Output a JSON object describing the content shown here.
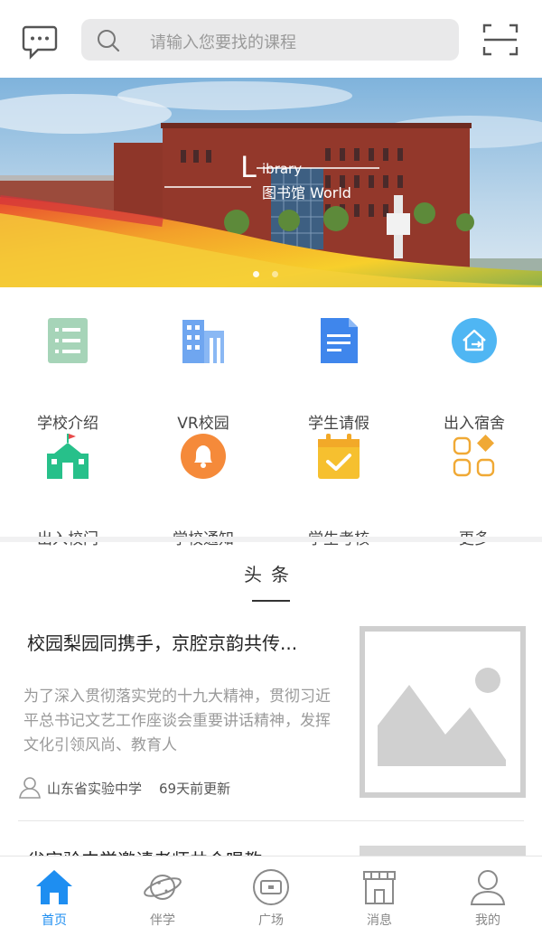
{
  "header": {
    "search_placeholder": "请输入您要找的课程",
    "message_icon": "message-bubble-icon",
    "search_icon": "search-icon",
    "scan_icon": "scan-icon"
  },
  "banner": {
    "title_l": "L",
    "title_rest": "ibrary",
    "subtitle": "图书馆 World",
    "dots": 2,
    "active_dot": 0
  },
  "grid": {
    "items": [
      {
        "label": "学校介绍",
        "icon": "school-intro-icon",
        "color": "#9fd1b5"
      },
      {
        "label": "VR校园",
        "icon": "buildings-icon",
        "color": "#6fa6f0"
      },
      {
        "label": "学生请假",
        "icon": "document-icon",
        "color": "#3f86ec"
      },
      {
        "label": "出入宿舍",
        "icon": "home-exit-icon",
        "color": "#4fb6f3"
      },
      {
        "label": "出入校门",
        "icon": "school-gate-icon",
        "color": "#27c08a"
      },
      {
        "label": "学校通知",
        "icon": "bell-icon",
        "color": "#f58a3a"
      },
      {
        "label": "学生考核",
        "icon": "calendar-check-icon",
        "color": "#f6c02f"
      },
      {
        "label": "更多",
        "icon": "more-apps-icon",
        "color": "#f0a935"
      }
    ]
  },
  "headline": {
    "section_title": "头条",
    "articles": [
      {
        "title": "校园梨园同携手，京腔京韵共传...",
        "desc": "为了深入贯彻落实党的十九大精神，贯彻习近平总书记文艺工作座谈会重要讲话精神，发挥文化引领风尚、教育人",
        "school": "山东省实验中学",
        "time": "69天前更新"
      },
      {
        "title": "省实验中学邀请老师共合唱教"
      }
    ]
  },
  "tabbar": {
    "tabs": [
      {
        "label": "首页",
        "icon": "home-icon",
        "active": true
      },
      {
        "label": "伴学",
        "icon": "planet-icon",
        "active": false
      },
      {
        "label": "广场",
        "icon": "square-icon",
        "active": false
      },
      {
        "label": "消息",
        "icon": "shop-icon",
        "active": false
      },
      {
        "label": "我的",
        "icon": "user-icon",
        "active": false
      }
    ],
    "active_color": "#1e8ef1",
    "inactive_color": "#888888"
  }
}
